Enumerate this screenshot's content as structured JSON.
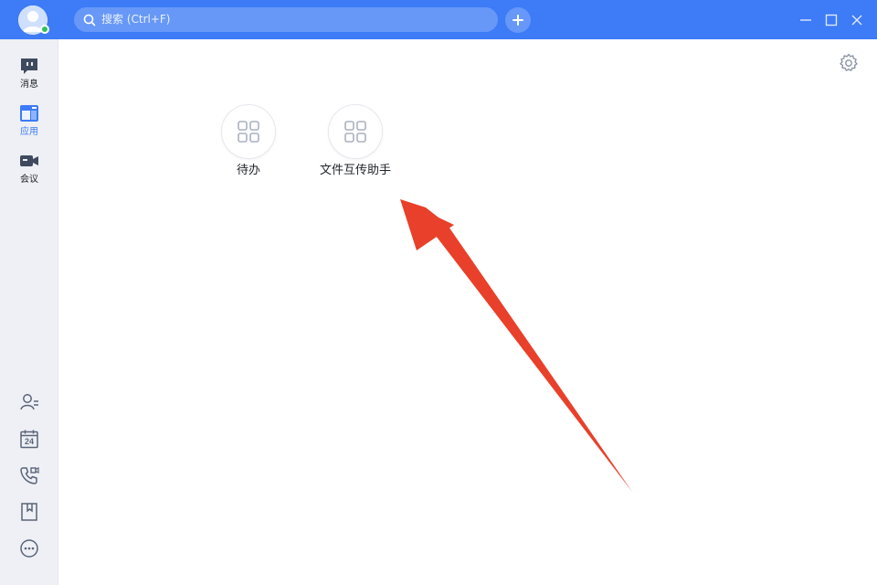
{
  "header": {
    "search_placeholder": "搜索 (Ctrl+F)",
    "accent_color": "#3d7bf7"
  },
  "sidebar": {
    "items": [
      {
        "label": "消息",
        "icon": "chat-icon"
      },
      {
        "label": "应用",
        "icon": "apps-icon",
        "active": true
      },
      {
        "label": "会议",
        "icon": "video-camera-icon"
      }
    ],
    "bottom_icons": [
      "contacts-icon",
      "calendar-icon",
      "phone-icon",
      "bookmark-icon",
      "more-icon"
    ],
    "calendar_day": "24"
  },
  "main": {
    "apps": [
      {
        "label": "待办",
        "icon": "app-grid-icon"
      },
      {
        "label": "文件互传助手",
        "icon": "app-grid-icon"
      }
    ],
    "annotation": {
      "color": "#e8402a",
      "description_icon": "red-arrow-annotation"
    }
  }
}
